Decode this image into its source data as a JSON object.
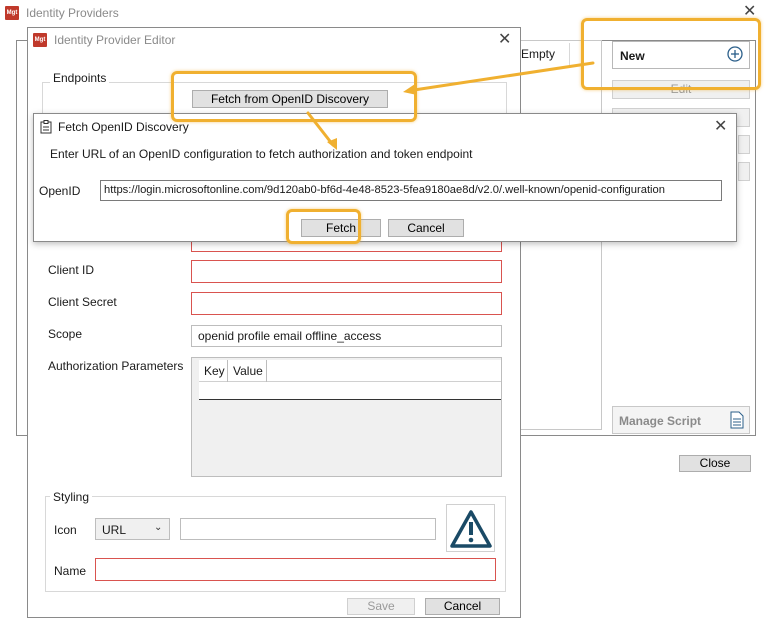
{
  "providers_window": {
    "title": "Identity Providers",
    "list_header_empty": "Empty",
    "new_button": "New",
    "edit_button": "Edit",
    "manage_script_button": "Manage Script",
    "close_button": "Close"
  },
  "editor": {
    "title": "Identity Provider Editor",
    "endpoints_label": "Endpoints",
    "fetch_discovery_button": "Fetch from OpenID Discovery",
    "client_id_label": "Client ID",
    "client_secret_label": "Client Secret",
    "scope_label": "Scope",
    "scope_value": "openid profile email offline_access",
    "auth_params_label": "Authorization Parameters",
    "auth_params_columns": [
      "Key",
      "Value"
    ],
    "styling_label": "Styling",
    "icon_label": "Icon",
    "icon_type_selected": "URL",
    "name_label": "Name",
    "save_button": "Save",
    "cancel_button": "Cancel"
  },
  "discovery_dialog": {
    "title": "Fetch OpenID Discovery",
    "instruction": "Enter URL of an OpenID configuration to fetch authorization and token endpoint",
    "openid_label": "OpenID",
    "openid_url": "https://login.microsoftonline.com/9d120ab0-bf6d-4e48-8523-5fea9180ae8d/v2.0/.well-known/openid-configuration",
    "fetch_button": "Fetch",
    "cancel_button": "Cancel"
  },
  "logo_text": "Mgt",
  "colors": {
    "highlight": "#f0b030",
    "error_border": "#d9534f",
    "warning_icon": "#1a4a66"
  }
}
